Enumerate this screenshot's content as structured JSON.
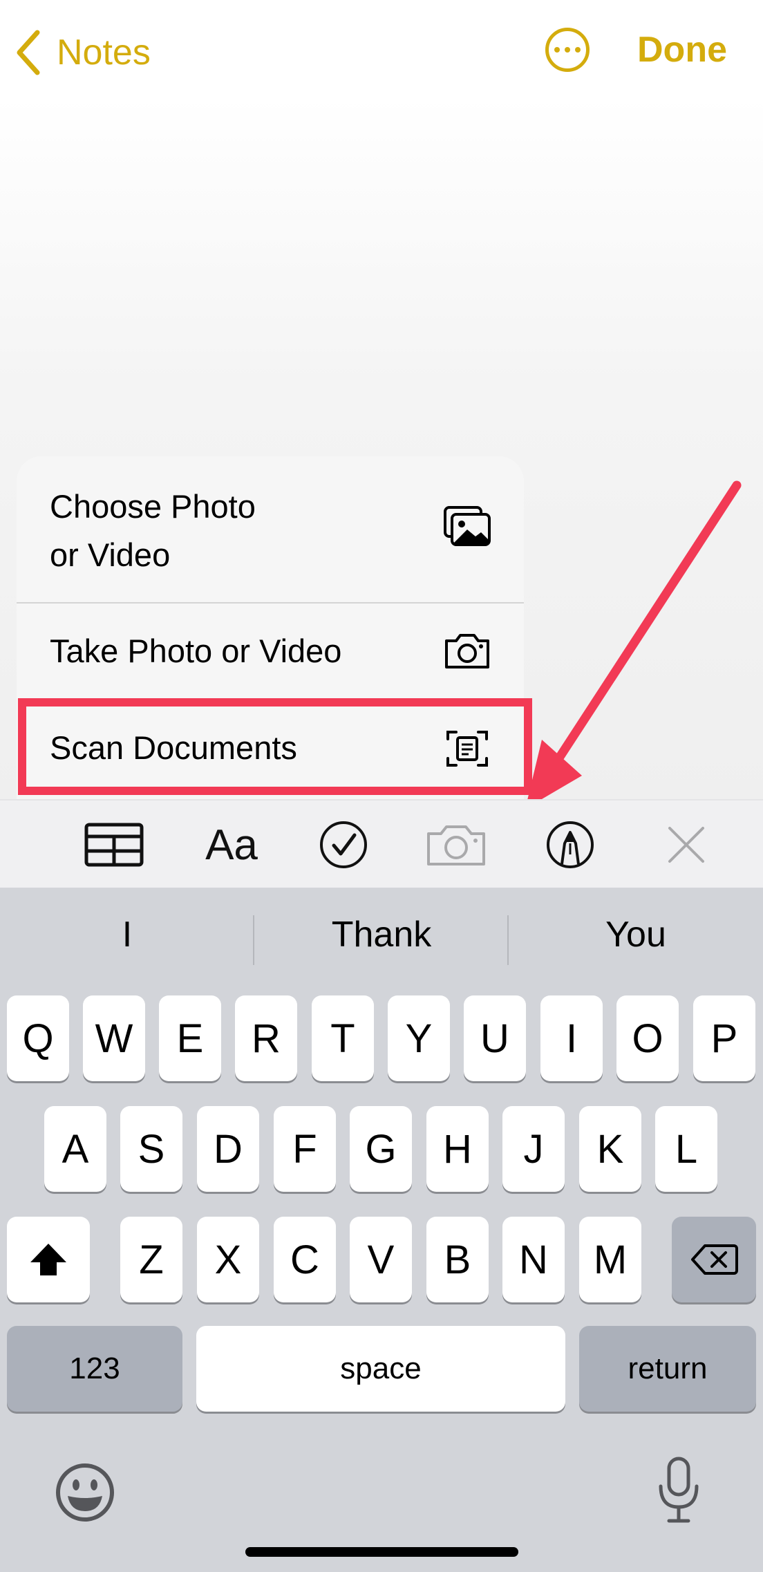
{
  "nav": {
    "back_label": "Notes",
    "more_icon": "ellipsis-circle-icon",
    "done_label": "Done",
    "accent": "#d4ac0d"
  },
  "attachment_menu": {
    "items": [
      {
        "label_line1": "Choose Photo",
        "label_line2": "or Video",
        "icon": "photo-library-icon"
      },
      {
        "label": "Take Photo or Video",
        "icon": "camera-icon"
      },
      {
        "label": "Scan Documents",
        "icon": "doc-scanner-icon"
      }
    ],
    "highlight_color": "#f23a55"
  },
  "toolbar": {
    "items": [
      {
        "name": "table",
        "icon": "table-icon"
      },
      {
        "name": "format",
        "text": "Aa",
        "icon": "text-format-icon"
      },
      {
        "name": "checklist",
        "icon": "checklist-icon"
      },
      {
        "name": "camera",
        "icon": "camera-icon",
        "state": "active"
      },
      {
        "name": "markup",
        "icon": "markup-pen-icon"
      },
      {
        "name": "close",
        "icon": "close-icon"
      }
    ]
  },
  "keyboard": {
    "suggestions": [
      "I",
      "Thank",
      "You"
    ],
    "row1": [
      "Q",
      "W",
      "E",
      "R",
      "T",
      "Y",
      "U",
      "I",
      "O",
      "P"
    ],
    "row2": [
      "A",
      "S",
      "D",
      "F",
      "G",
      "H",
      "J",
      "K",
      "L"
    ],
    "row3": [
      "Z",
      "X",
      "C",
      "V",
      "B",
      "N",
      "M"
    ],
    "shift_icon": "shift-icon",
    "delete_icon": "delete-backspace-icon",
    "numbers_label": "123",
    "space_label": "space",
    "return_label": "return",
    "emoji_icon": "emoji-icon",
    "mic_icon": "microphone-icon"
  }
}
